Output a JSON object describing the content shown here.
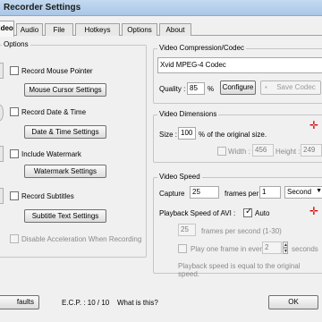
{
  "window": {
    "title": "Recorder Settings"
  },
  "tabs": [
    {
      "label": "Video"
    },
    {
      "label": "Audio"
    },
    {
      "label": "File"
    },
    {
      "label": "Hotkeys"
    },
    {
      "label": "Options"
    },
    {
      "label": "About"
    }
  ],
  "options": {
    "group_label": "Options",
    "mouse_pointer": {
      "label": "Record Mouse Pointer",
      "checked": false,
      "button": "Mouse Cursor Settings"
    },
    "date_time": {
      "label": "Record Date & Time",
      "checked": false,
      "button": "Date & Time Settings"
    },
    "watermark": {
      "label": "Include Watermark",
      "checked": false,
      "button": "Watermark Settings"
    },
    "subtitles": {
      "label": "Record Subtitles",
      "checked": false,
      "button": "Subtitle Text Settings"
    },
    "disable_accel": {
      "label": "Disable Acceleration When Recording",
      "checked": false
    }
  },
  "codec": {
    "group_label": "Video Compression/Codec",
    "selected": "Xvid MPEG-4 Codec",
    "quality_label": "Quality :",
    "quality_value": "85",
    "quality_unit": "%",
    "configure_button": "Configure",
    "save_button": "Save Codec"
  },
  "dimensions": {
    "group_label": "Video Dimensions",
    "size_label": "Size :",
    "size_value": "100",
    "size_suffix": "% of the original size.",
    "width_label": "Width :",
    "width_value": "456",
    "height_label": "Height :",
    "height_value": "249"
  },
  "speed": {
    "group_label": "Video Speed",
    "capture_label": "Capture",
    "capture_value": "25",
    "frames_per_label": "frames per",
    "frames_per_value": "1",
    "unit": "Second",
    "playback_label": "Playback Speed of AVI :",
    "auto_label": "Auto",
    "auto_checked": true,
    "fps_value": "25",
    "fps_label": "frames per second (1-30)",
    "play_one_label": "Play one frame in every",
    "play_one_value": "2",
    "seconds_label": "seconds",
    "note": "Playback speed is equal to the original speed."
  },
  "footer": {
    "defaults_button": "faults",
    "ecp_label": "E.C.P. : 10 / 10",
    "what_link": "What is this?",
    "ok_button": "OK"
  }
}
